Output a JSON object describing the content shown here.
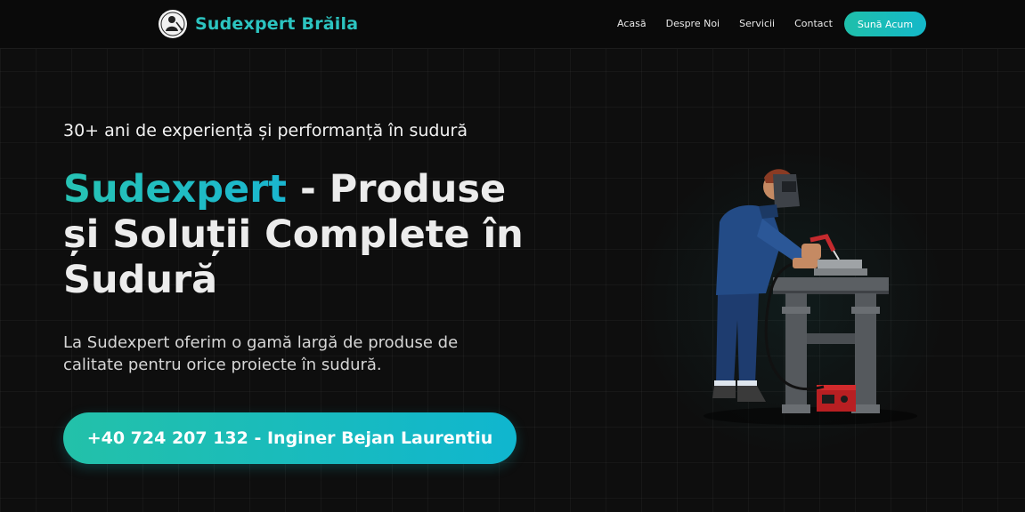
{
  "header": {
    "brand_name": "Sudexpert Brăila",
    "nav": [
      "Acasă",
      "Despre Noi",
      "Servicii",
      "Contact"
    ],
    "cta_label": "Sună Acum"
  },
  "hero": {
    "eyebrow": "30+ ani de experiență și performanță în sudură",
    "title_accent": "Sudexpert",
    "title_rest": " - Produse și Soluții Complete în Sudură",
    "description": "La Sudexpert oferim o gamă largă de produse de calitate pentru orice proiecte în sudură.",
    "phone_button": "+40 724 207 132 - Inginer Bejan Laurentiu"
  },
  "icons": [
    "welder-logo-icon",
    "welder-illustration"
  ],
  "colors": {
    "accent": "#2cc4c0",
    "background": "#0e0e0e",
    "button_gradient_start": "#23c1a9",
    "button_gradient_end": "#10b6cf"
  }
}
